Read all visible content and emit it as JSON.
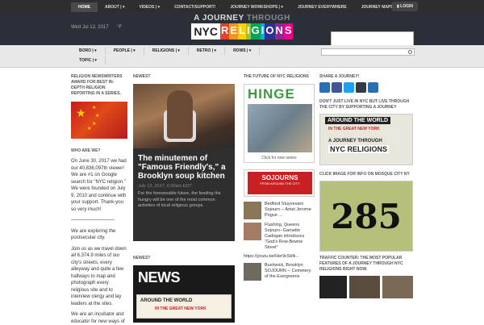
{
  "topnav": {
    "items": [
      "HOME",
      "ABOUT | ▾",
      "VIDEOS | ▾",
      "CONTACT/SUPPORT!",
      "JOURNEY WORKSHOPS | ▾",
      "JOURNEY EVERYWHERE",
      "JOURNEY MAPS | ▾"
    ],
    "login_label": "LOGIN"
  },
  "header": {
    "date": "Wed Jul 12, 2017",
    "temp": "°F",
    "logo_line1_a": "A JOURNEY",
    "logo_line1_b": "THROUGH",
    "logo_nyc": "NYC",
    "logo_religions": [
      "R",
      "E",
      "L",
      "I",
      "G",
      "I",
      "O",
      "N",
      "S"
    ],
    "logo_colors": [
      "#e8412c",
      "#f7941d",
      "#ffd200",
      "#8dc63f",
      "#00a651",
      "#00aeef",
      "#2e3192",
      "#92278f",
      "#ec008c"
    ]
  },
  "subnav": {
    "row1": [
      "BORO | ▾",
      "PEOPLE | ▾",
      "RELIGIONS | ▾",
      "RETRO | ▾",
      "ROWS | ▾"
    ],
    "row2": [
      "TOPIC | ▾"
    ]
  },
  "left": {
    "award_heading": "RELIGION NEWSWRITERS AWARD FOR BEST IN-DEPTH RELIGION REPORTING IN A SERIES.",
    "who_heading": "WHO ARE WE?",
    "p1": "On June 30, 2017 we had our 40,836,097th viewer! We are #1 on Google search for \"NYC religion.\" We were founded on July 9, 2010 and continue with your support. Thank-you so very much!",
    "divider": "—————————",
    "p2": "We are exploring the postsecular city.",
    "p3": "Join us as we travel down all 6,374.9 miles of our city's streets, every alleyway and quite a few hallways to map and photograph every religious site and to interview clergy and lay leaders at the sites.",
    "p4": "We are an incubator and educator for new ways of"
  },
  "middle": {
    "newest_label": "NEWEST",
    "feature_title": "The minutemen of \"Famous Friendly's,\" a Brooklyn soup kitchen",
    "feature_date": "July 12, 2017, 6:00am EDT",
    "feature_excerpt": "For the foreseeable future, the feeding the hungry will be one of the most common activities of local religious groups.",
    "newest_label_2": "NEWEST",
    "news_word": "NEWS",
    "news_around": "AROUND THE WORLD",
    "news_sub": "IN THE GREAT NEW YORK"
  },
  "future": {
    "heading": "THE FUTURE OF NYC RELIGIONS",
    "hinge_word": "HINGE",
    "hinge_caption": "Click for new series",
    "sojourns_title": "SOJOURNS",
    "sojourns_sub": "FROM AROUND THE CITY",
    "items": [
      "Bedford Stuyvesant Sojourn -- Artist Jerome Pogue ...",
      "Flushing, Queens Sojourn--Garnette Cadogan introduces \"God's Row-Bowne Street\"",
      "https://youtu.be/Her9cSkfk...",
      "Bushwick, Brooklyn SOJOURN -- Cemetery of the Evergreens"
    ]
  },
  "right": {
    "share_heading": "SHARE A JOURNEY!",
    "share_icons": [
      "email-icon",
      "facebook-icon",
      "twitter-icon",
      "buffer-icon",
      "share-icon"
    ],
    "share_colors": [
      "#2a6fb3",
      "#3b5998",
      "#1da1f2",
      "#323b43",
      "#2a6fb3"
    ],
    "support_heading": "DON'T JUST LIVE IN NYC BUT LIVE THROUGH THE CITY BY SUPPORTING A JOURNEY",
    "atw_around": "AROUND THE WORLD",
    "atw_sub": "IN THE GREAT NEW YORK",
    "atw_journey": "A JOURNEY THROUGH",
    "atw_nyc": "NYC RELIGIONS",
    "mosque_heading": "CLICK IMAGE FOR INFO ON MOSQUE CITY NY",
    "mosque_number": "285",
    "traffic_heading": "TRAFFIC COUNTER: THE MOST POPULAR FEATURES OF A JOURNEY THROUGH NYC RELIGIONS RIGHT NOW."
  }
}
